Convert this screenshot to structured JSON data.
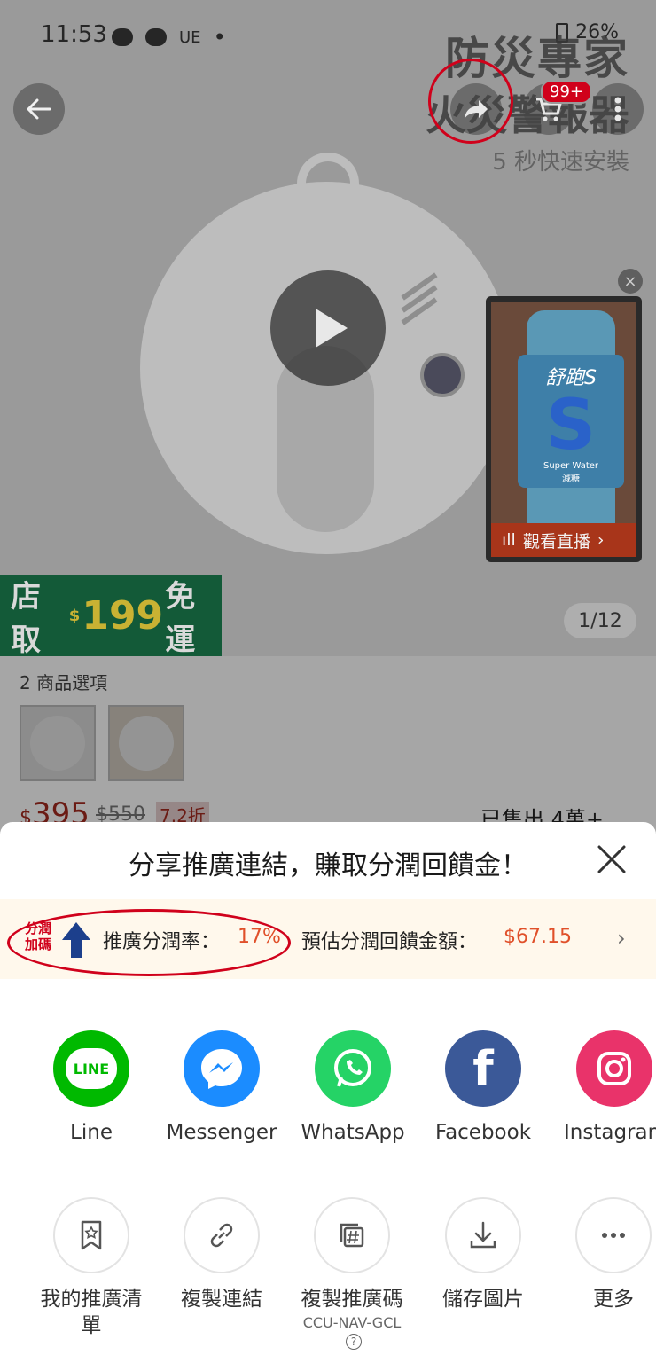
{
  "status": {
    "time": "11:53",
    "carrier_icons": [
      "chat-icon",
      "line-icon"
    ],
    "ue_text": "UE",
    "battery": "26%"
  },
  "watermark": {
    "title": "防災專家",
    "line2": "火災警報器",
    "line3": "5 秒快速安裝"
  },
  "product": {
    "cart_badge": "99+",
    "promo": {
      "prefix": "店取",
      "currency": "$",
      "amount": "199",
      "suffix": "免運"
    },
    "page_indicator": "1/12",
    "live": {
      "cta": "觀看直播",
      "bottle_brand": "舒跑S",
      "bottle_sub": "Super Water",
      "bottle_note": "減糖"
    },
    "options_label": "2 商品選項",
    "price_currency": "$",
    "price": "395",
    "price_original": "$550",
    "discount": "7.2折",
    "sold": "已售出 4萬+"
  },
  "sheet": {
    "title": "分享推廣連結，賺取分潤回饋金！",
    "commission": {
      "logo_text": [
        "分潤",
        "加碼"
      ],
      "rate_label": "推廣分潤率：",
      "rate_value": "17%",
      "est_label": "預估分潤回饋金額：",
      "est_value": "$67.15"
    },
    "apps": [
      {
        "name": "line",
        "label": "Line",
        "color": "#00b900",
        "icon_text": "LINE"
      },
      {
        "name": "messenger",
        "label": "Messenger",
        "color": "#1b8cff"
      },
      {
        "name": "whatsapp",
        "label": "WhatsApp",
        "color": "#25d366"
      },
      {
        "name": "facebook",
        "label": "Facebook",
        "color": "#3b5998",
        "icon_text": "f"
      },
      {
        "name": "instagram",
        "label": "Instagran",
        "color": "#e9336a"
      }
    ],
    "actions": [
      {
        "name": "my-promo-list",
        "label": "我的推廣清單"
      },
      {
        "name": "copy-link",
        "label": "複製連結"
      },
      {
        "name": "copy-promo-code",
        "label": "複製推廣碼",
        "sub": "CCU-NAV-GCL"
      },
      {
        "name": "save-image",
        "label": "儲存圖片"
      },
      {
        "name": "more",
        "label": "更多"
      }
    ]
  },
  "colors": {
    "accent_red": "#d0011b",
    "commission_value": "#e0502a",
    "commission_bg": "#fff8ec"
  }
}
